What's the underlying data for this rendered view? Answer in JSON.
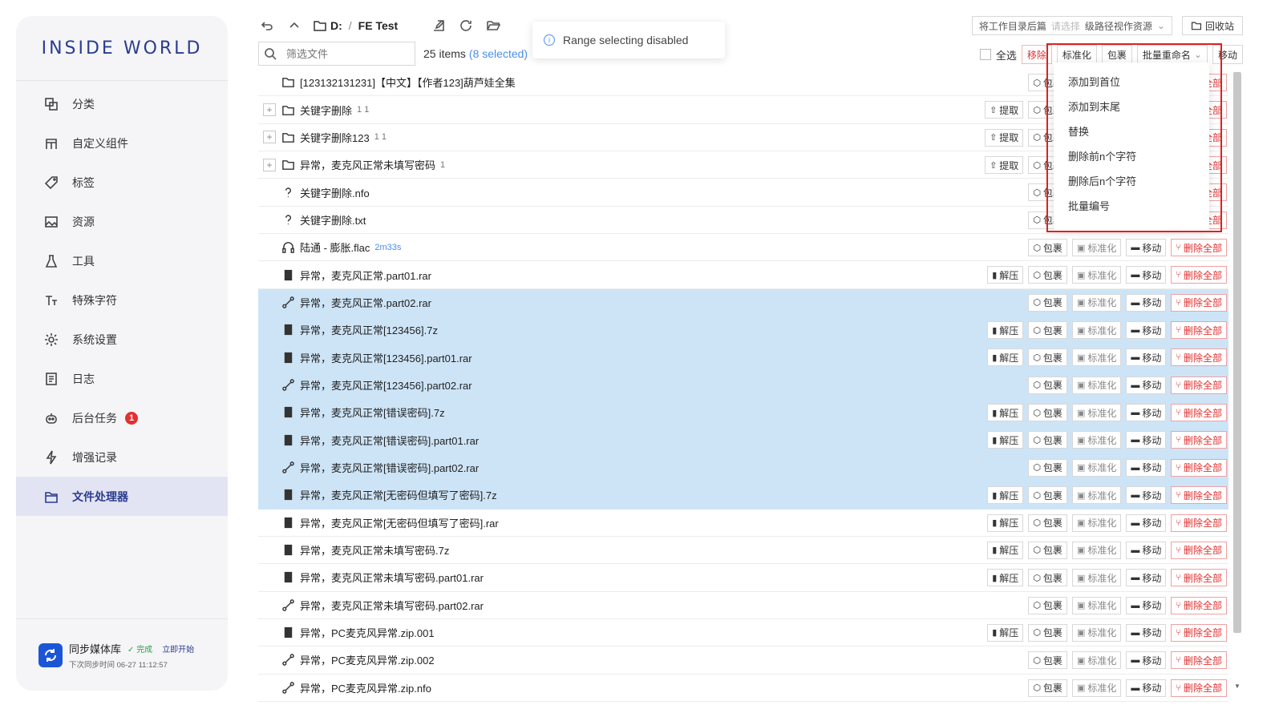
{
  "app": {
    "logo": "INSIDE WORLD"
  },
  "sidebar": {
    "items": [
      {
        "label": "分类",
        "icon": "category-icon"
      },
      {
        "label": "自定义组件",
        "icon": "component-icon"
      },
      {
        "label": "标签",
        "icon": "tag-icon"
      },
      {
        "label": "资源",
        "icon": "image-icon"
      },
      {
        "label": "工具",
        "icon": "flask-icon"
      },
      {
        "label": "特殊字符",
        "icon": "text-icon"
      },
      {
        "label": "系统设置",
        "icon": "gear-icon"
      },
      {
        "label": "日志",
        "icon": "log-icon"
      },
      {
        "label": "后台任务",
        "icon": "robot-icon",
        "badge": "1"
      },
      {
        "label": "增强记录",
        "icon": "bolt-icon"
      },
      {
        "label": "文件处理器",
        "icon": "folder-icon",
        "active": true
      }
    ],
    "sync": {
      "title": "同步媒体库",
      "status": "完成",
      "start": "立即开始",
      "next": "下次同步时间 06-27 11:12:57"
    }
  },
  "toolbar": {
    "drive": "D:",
    "sep": "/",
    "folder": "FE Test",
    "tip": "Range selecting disabled",
    "workdir_label": "将工作目录后篇",
    "workdir_placeholder": "请选择",
    "workdir_value": "级路径视作资源",
    "recycle": "回收站",
    "filter_placeholder": "筛选文件",
    "count": "25 items",
    "selected": "(8 selected)",
    "select_all": "全选",
    "bulk_buttons": [
      "移除",
      "标准化",
      "包裹",
      "批量重命名",
      "移动"
    ]
  },
  "dropdown": [
    "添加到首位",
    "添加到末尾",
    "替换",
    "删除前n个字符",
    "删除后n个字符",
    "批量编号"
  ],
  "actions": {
    "extract": "提取",
    "unzip": "解压",
    "wrap": "包裹",
    "normalize": "标准化",
    "move": "移动",
    "delete_all": "删除全部"
  },
  "files": [
    {
      "name": "[123132131231]【中文】【作者123]葫芦娃全集",
      "type": "folder",
      "expand": false,
      "sel": false
    },
    {
      "name": "关键字删除",
      "type": "folder",
      "expand": true,
      "meta": "1 1",
      "extract": true,
      "sel": false
    },
    {
      "name": "关键字删除123",
      "type": "folder",
      "expand": true,
      "meta": "1 1",
      "extract": true,
      "sel": false
    },
    {
      "name": "异常，麦克风正常未填写密码",
      "type": "folder",
      "expand": true,
      "meta": "1",
      "extract": true,
      "sel": false
    },
    {
      "name": "关键字删除.nfo",
      "type": "unknown",
      "sel": false
    },
    {
      "name": "关键字删除.txt",
      "type": "unknown",
      "sel": false
    },
    {
      "name": "陆通 - 膨胀.flac",
      "type": "audio",
      "meta": "2m33s",
      "sel": false
    },
    {
      "name": "异常，麦克风正常.part01.rar",
      "type": "zip",
      "unzip": true,
      "sel": false
    },
    {
      "name": "异常，麦克风正常.part02.rar",
      "type": "link",
      "sel": true
    },
    {
      "name": "异常，麦克风正常[123456].7z",
      "type": "zip",
      "unzip": true,
      "sel": true
    },
    {
      "name": "异常，麦克风正常[123456].part01.rar",
      "type": "zip",
      "unzip": true,
      "sel": true
    },
    {
      "name": "异常，麦克风正常[123456].part02.rar",
      "type": "link",
      "sel": true
    },
    {
      "name": "异常，麦克风正常[错误密码].7z",
      "type": "zip",
      "unzip": true,
      "sel": true
    },
    {
      "name": "异常，麦克风正常[错误密码].part01.rar",
      "type": "zip",
      "unzip": true,
      "sel": true
    },
    {
      "name": "异常，麦克风正常[错误密码].part02.rar",
      "type": "link",
      "sel": true
    },
    {
      "name": "异常，麦克风正常[无密码但填写了密码].7z",
      "type": "zip",
      "unzip": true,
      "sel": true
    },
    {
      "name": "异常，麦克风正常[无密码但填写了密码].rar",
      "type": "zip",
      "unzip": true,
      "sel": false
    },
    {
      "name": "异常，麦克风正常未填写密码.7z",
      "type": "zip",
      "unzip": true,
      "sel": false
    },
    {
      "name": "异常，麦克风正常未填写密码.part01.rar",
      "type": "zip",
      "unzip": true,
      "sel": false
    },
    {
      "name": "异常，麦克风正常未填写密码.part02.rar",
      "type": "link",
      "sel": false
    },
    {
      "name": "异常，PC麦克风异常.zip.001",
      "type": "zip",
      "unzip": true,
      "sel": false
    },
    {
      "name": "异常，PC麦克风异常.zip.002",
      "type": "link",
      "sel": false
    },
    {
      "name": "异常，PC麦克风异常.zip.nfo",
      "type": "link",
      "sel": false
    }
  ]
}
